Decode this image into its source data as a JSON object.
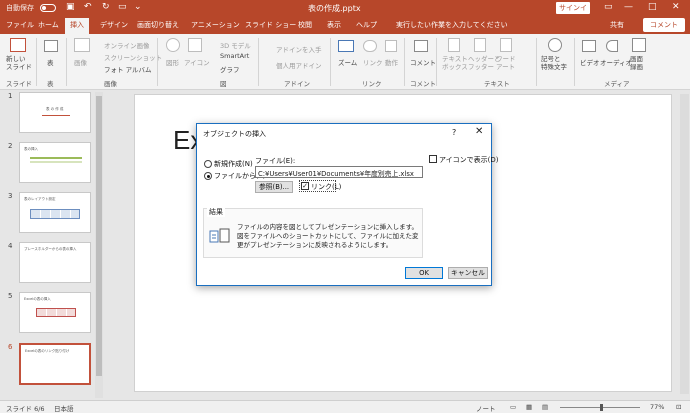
{
  "titlebar": {
    "autosave": "自動保存",
    "autosave_state": "オフ",
    "doc_title": "表の作成.pptx",
    "signin": "サインイン"
  },
  "tabs": [
    "ファイル",
    "ホーム",
    "挿入",
    "デザイン",
    "画面切り替え",
    "アニメーション",
    "スライド ショー",
    "校閲",
    "表示",
    "ヘルプ"
  ],
  "active_tab": "挿入",
  "tell_me": "実行したい作業を入力してください",
  "share": "共有",
  "comment": "コメント",
  "ribbon": {
    "new_slide": "新しい\nスライド",
    "table": "表",
    "image": "画像",
    "online_image": "オンライン画像",
    "screenshot": "スクリーンショット",
    "photo_album": "フォト アルバム",
    "shapes": "図形",
    "icons": "アイコン",
    "model3d": "3D モデル",
    "smartart": "SmartArt",
    "graph": "グラフ",
    "get_addins": "アドインを入手",
    "personal_addins": "個人用アドイン",
    "zoom": "ズーム",
    "link": "リンク",
    "action": "動作",
    "comment": "コメント",
    "textbox": "テキスト\nボックス",
    "header_footer": "ヘッダーと\nフッター",
    "wordart": "ワード\nアート",
    "symbols": "記号と\n特殊文字",
    "video": "ビデオ",
    "audio": "オーディオ",
    "screen_record": "画面\n録画",
    "groups": {
      "slides": "スライド",
      "table": "表",
      "images": "画像",
      "illustrations": "図",
      "addins": "アドイン",
      "links": "リンク",
      "comments": "コメント",
      "text": "テキスト",
      "media": "メディア"
    }
  },
  "thumbnails": [
    {
      "num": "1",
      "text": "表 の 作 成"
    },
    {
      "num": "2",
      "text": "表の挿入"
    },
    {
      "num": "3",
      "text": "表のレイアウト設定"
    },
    {
      "num": "4",
      "text": "プレースホルダーからの表の挿入"
    },
    {
      "num": "5",
      "text": "Excelの表の挿入"
    },
    {
      "num": "6",
      "text": "Excelの表のリンク貼り付け"
    }
  ],
  "slide": {
    "title": "Ex"
  },
  "dialog": {
    "title": "オブジェクトの挿入",
    "help": "?",
    "close": "✕",
    "opt_new": "新規作成(N)",
    "opt_file": "ファイルから(F)",
    "file_label": "ファイル(E):",
    "file_path": "C:¥Users¥User01¥Documents¥年度別売上.xlsx",
    "browse": "参照(B)...",
    "link": "リンク(L)",
    "link_checked": true,
    "icon_display": "アイコンで表示(D)",
    "icon_checked": false,
    "result_label": "結果",
    "result_text": "ファイルの内容を図としてプレゼンテーションに挿入します。図をファイルへのショートカットにして、ファイルに加えた変更がプレゼンテーションに反映されるようにします。",
    "ok": "OK",
    "cancel": "キャンセル"
  },
  "status": {
    "slide": "スライド 6/6",
    "language": "日本語",
    "note": "ノート",
    "zoom": "77%"
  }
}
